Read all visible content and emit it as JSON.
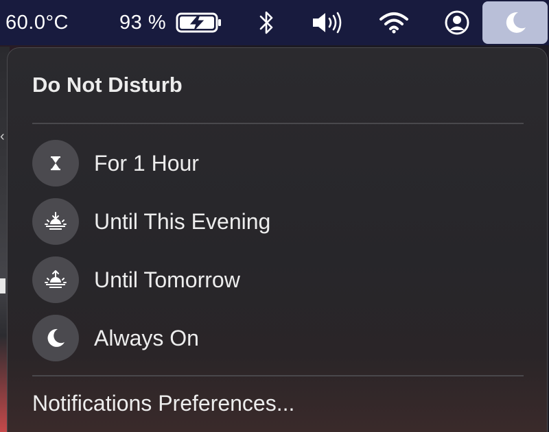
{
  "menubar": {
    "temperature": "60.0°C",
    "battery_percent": "93 %",
    "battery_icon": "battery-charging-icon",
    "bluetooth_icon": "bluetooth-icon",
    "volume_icon": "volume-icon",
    "wifi_icon": "wifi-icon",
    "user_icon": "user-account-icon",
    "focus_icon": "moon-icon"
  },
  "panel": {
    "title": "Do Not Disturb",
    "options": [
      {
        "label": "For 1 Hour",
        "icon": "hourglass-icon"
      },
      {
        "label": "Until This Evening",
        "icon": "sunset-icon"
      },
      {
        "label": "Until Tomorrow",
        "icon": "sunrise-icon"
      },
      {
        "label": "Always On",
        "icon": "moon-icon"
      }
    ],
    "preferences_label": "Notifications Preferences..."
  },
  "colors": {
    "menubar_bg": "#181b3e",
    "panel_bg": "#2b2a2e",
    "icon_circle": "#4b4a4f",
    "active_slot": "#b9bfd8"
  }
}
